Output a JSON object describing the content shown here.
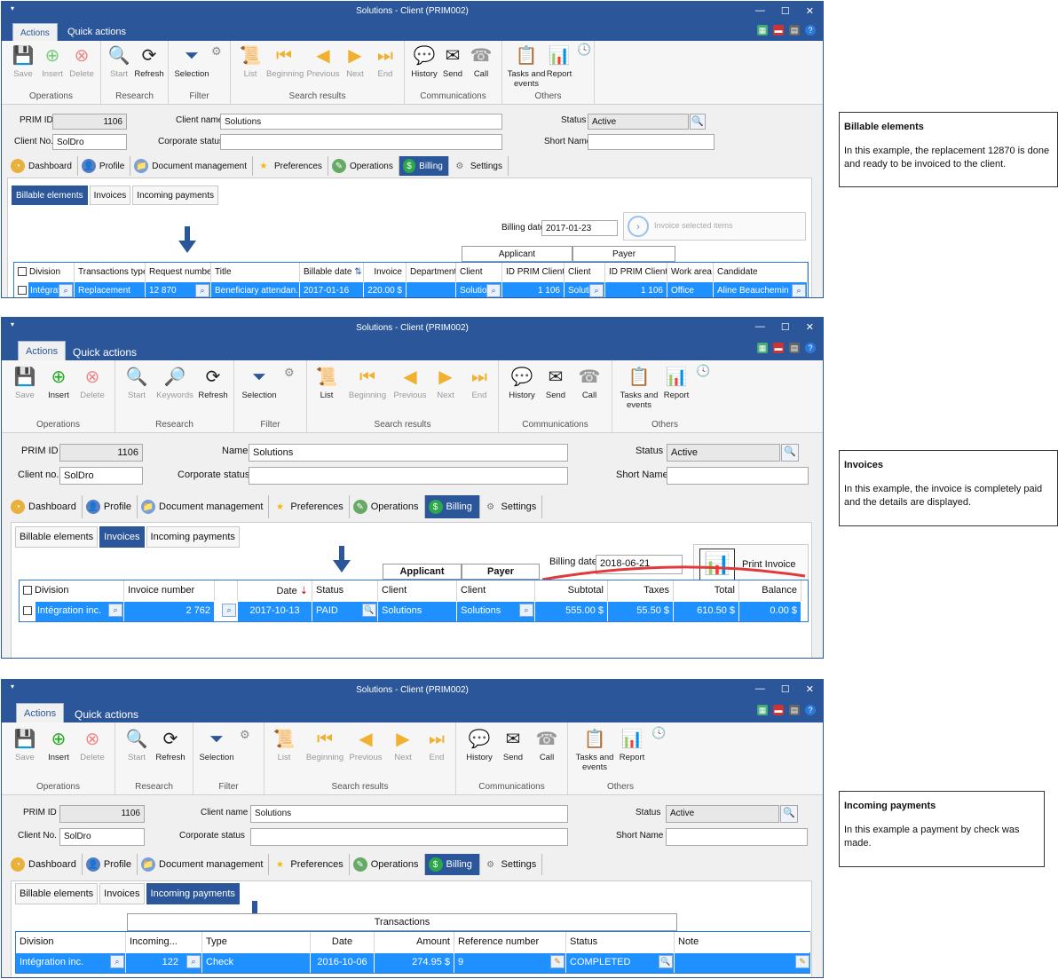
{
  "window_title": "Solutions - Client (PRIM002)",
  "ribbon_tabs": {
    "actions": "Actions",
    "quick_actions": "Quick actions"
  },
  "ribbon": {
    "save": "Save",
    "insert": "Insert",
    "delete": "Delete",
    "start": "Start",
    "keywords": "Keywords",
    "refresh": "Refresh",
    "selection": "Selection",
    "list": "List",
    "beginning": "Beginning",
    "previous": "Previous",
    "next": "Next",
    "end": "End",
    "history": "History",
    "send": "Send",
    "call": "Call",
    "tasks": "Tasks and events",
    "report": "Report",
    "groups": {
      "operations": "Operations",
      "research": "Research",
      "filter": "Filter",
      "search_results": "Search results",
      "communications": "Communications",
      "others": "Others"
    }
  },
  "form": {
    "prim_id_label": "PRIM ID",
    "prim_id": "1106",
    "client_name_label": "Client name",
    "name_label": "Name",
    "client_name": "Solutions",
    "status_label": "Status",
    "status": "Active",
    "client_no_label_a": "Client No.",
    "client_no_label_b": "Client no.",
    "client_no": "SolDro",
    "corporate_status_label": "Corporate status",
    "short_name_label": "Short Name"
  },
  "main_tabs": {
    "dashboard": "Dashboard",
    "profile": "Profile",
    "documents": "Document management",
    "preferences": "Preferences",
    "operations": "Operations",
    "billing": "Billing",
    "settings": "Settings"
  },
  "sub_tabs": {
    "billable": "Billable elements",
    "invoices": "Invoices",
    "payments": "Incoming payments"
  },
  "billable": {
    "billing_date_label": "Billing date",
    "billing_date": "2017-01-23",
    "invoice_btn": "Invoice selected items",
    "group_applicant": "Applicant",
    "group_payer": "Payer",
    "columns": [
      "Division",
      "Transactions type",
      "Request number",
      "Title",
      "Billable date",
      "Invoice",
      "Department",
      "Client",
      "ID PRIM Client",
      "Client",
      "ID PRIM Client",
      "Work area",
      "Candidate"
    ],
    "row": [
      "Intégratio",
      "Replacement",
      "12 870",
      "Beneficiary attendan...",
      "2017-01-16",
      "220.00 $",
      "",
      "Solution",
      "1 106",
      "Solutio",
      "1 106",
      "Office",
      "Aline Beauchemin"
    ]
  },
  "invoices": {
    "billing_date_label": "Billing date",
    "billing_date": "2018-06-21",
    "print_btn": "Print Invoice",
    "group_applicant": "Applicant",
    "group_payer": "Payer",
    "columns": [
      "Division",
      "Invoice number",
      "",
      "Date",
      "Status",
      "Client",
      "Client",
      "Subtotal",
      "Taxes",
      "Total",
      "Balance"
    ],
    "row": [
      "Intégration inc.",
      "2 762",
      "",
      "2017-10-13",
      "PAID",
      "Solutions",
      "Solutions",
      "555.00 $",
      "55.50 $",
      "610.50 $",
      "0.00 $"
    ]
  },
  "payments": {
    "group_transactions": "Transactions",
    "columns": [
      "Division",
      "Incoming...",
      "Type",
      "Date",
      "Amount",
      "Reference number",
      "Status",
      "Note"
    ],
    "row": [
      "Intégration inc.",
      "122",
      "Check",
      "2016-10-06",
      "274.95 $",
      "9",
      "COMPLETED",
      ""
    ]
  },
  "notes": [
    {
      "title": "Billable elements",
      "text": "In this example, the replacement 12870 is done and ready to be invoiced to the client."
    },
    {
      "title": "Invoices",
      "text": "In this example, the invoice is completely paid and the details are displayed."
    },
    {
      "title": "Incoming payments",
      "text": "In this example a payment by check was made."
    }
  ],
  "colors": {
    "accent": "#2b579a",
    "selected_row": "#1e90ff",
    "billing_tab": "#2b579a"
  }
}
